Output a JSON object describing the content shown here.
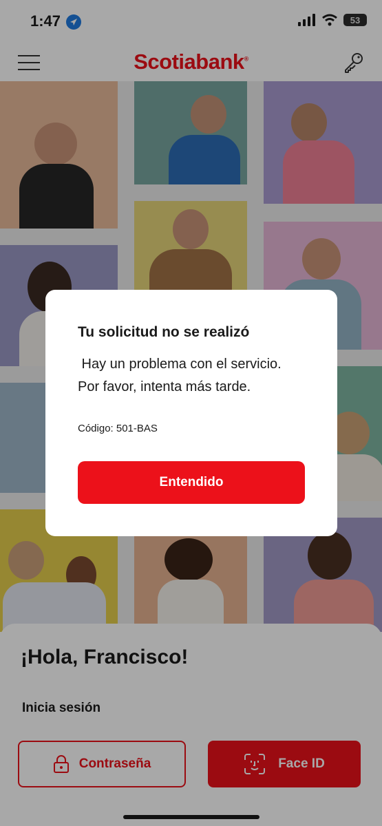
{
  "status_bar": {
    "time": "1:47",
    "battery": "53"
  },
  "header": {
    "brand": "Scotiabank"
  },
  "colors": {
    "brand_red": "#ec111a",
    "overlay": "rgba(0,0,0,0.34)"
  },
  "icons": [
    "location-arrow-icon",
    "signal-icon",
    "wifi-icon",
    "battery-icon",
    "menu-icon",
    "key-icon",
    "lock-icon",
    "face-id-icon"
  ],
  "login": {
    "greeting": "¡Hola, Francisco!",
    "prompt": "Inicia sesión",
    "password_button": "Contraseña",
    "faceid_button": "Face ID"
  },
  "dialog": {
    "title": "Tu solicitud no se realizó",
    "message_line1": " Hay un problema con el servicio.",
    "message_line2": "Por favor, intenta más tarde.",
    "code": "Código: 501-BAS",
    "button": "Entendido"
  }
}
